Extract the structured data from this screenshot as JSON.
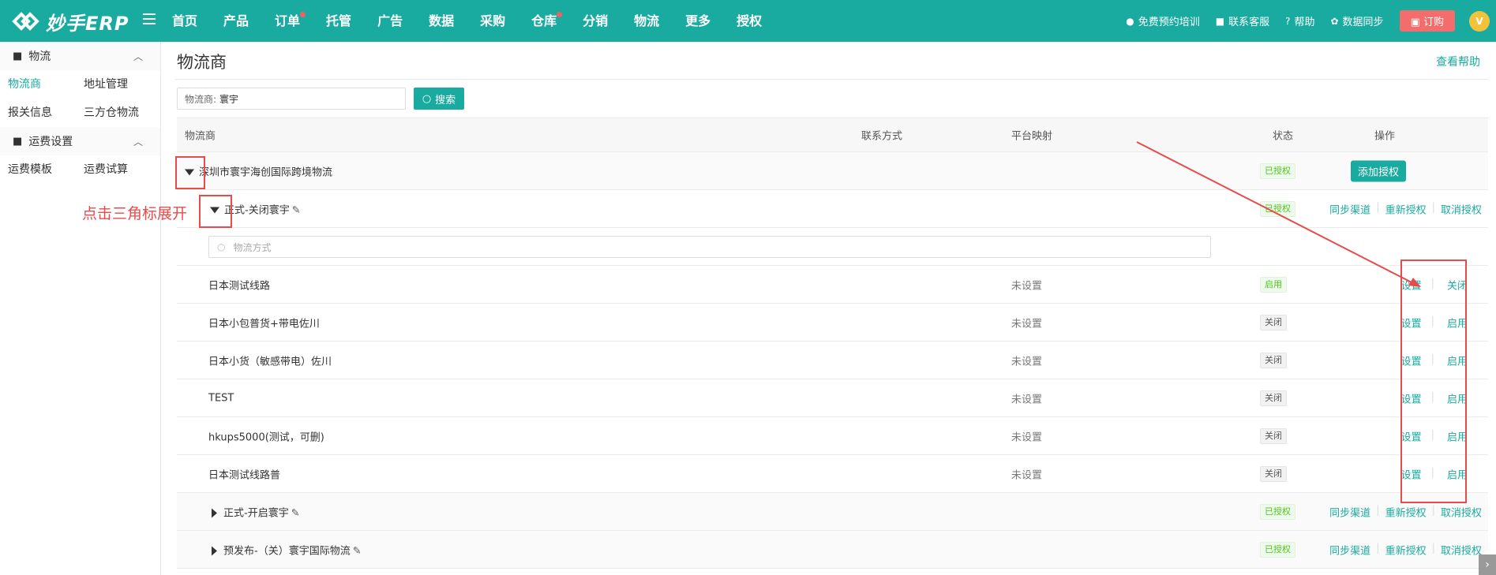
{
  "app": {
    "logo_text": "妙手ERP"
  },
  "nav": {
    "items": [
      {
        "label": "首页",
        "dot": false
      },
      {
        "label": "产品",
        "dot": false
      },
      {
        "label": "订单",
        "dot": true
      },
      {
        "label": "托管",
        "dot": false
      },
      {
        "label": "广告",
        "dot": false
      },
      {
        "label": "数据",
        "dot": false
      },
      {
        "label": "采购",
        "dot": false
      },
      {
        "label": "仓库",
        "dot": true
      },
      {
        "label": "分销",
        "dot": false
      },
      {
        "label": "物流",
        "dot": false
      },
      {
        "label": "更多",
        "dot": false
      },
      {
        "label": "授权",
        "dot": false
      }
    ]
  },
  "header_links": {
    "training": "免费预约培训",
    "support": "联系客服",
    "help": "帮助",
    "sync": "数据同步",
    "order": "订购",
    "avatar": "V"
  },
  "sidebar": {
    "group1": "物流",
    "group1_items": [
      "物流商",
      "地址管理",
      "报关信息",
      "三方仓物流"
    ],
    "group2": "运费设置",
    "group2_items": [
      "运费模板",
      "运费试算"
    ]
  },
  "page": {
    "title": "物流商",
    "help": "查看帮助",
    "search_label": "物流商:",
    "search_value": "寰宇",
    "search_button": "搜索"
  },
  "table": {
    "headers": {
      "name": "物流商",
      "contact": "联系方式",
      "mapping": "平台映射",
      "status": "状态",
      "ops": "操作"
    },
    "provider": {
      "name": "深圳市寰宇海创国际跨境物流",
      "status": "已授权",
      "add_auth": "添加授权"
    },
    "account1": {
      "name": "正式-关闭寰宇",
      "status": "已授权",
      "ops": [
        "同步渠道",
        "重新授权",
        "取消授权"
      ]
    },
    "method_placeholder": "物流方式",
    "lines": [
      {
        "name": "日本测试线路",
        "mapping": "未设置",
        "status": "启用",
        "status_on": true,
        "set": "设置",
        "toggle": "关闭"
      },
      {
        "name": "日本小包普货+带电佐川",
        "mapping": "未设置",
        "status": "关闭",
        "status_on": false,
        "set": "设置",
        "toggle": "启用"
      },
      {
        "name": "日本小货（敏感带电）佐川",
        "mapping": "未设置",
        "status": "关闭",
        "status_on": false,
        "set": "设置",
        "toggle": "启用"
      },
      {
        "name": "TEST",
        "mapping": "未设置",
        "status": "关闭",
        "status_on": false,
        "set": "设置",
        "toggle": "启用"
      },
      {
        "name": "hkups5000(测试，可删)",
        "mapping": "未设置",
        "status": "关闭",
        "status_on": false,
        "set": "设置",
        "toggle": "启用"
      },
      {
        "name": "日本测试线路普",
        "mapping": "未设置",
        "status": "关闭",
        "status_on": false,
        "set": "设置",
        "toggle": "启用"
      }
    ],
    "account2": {
      "name": "正式-开启寰宇",
      "status": "已授权",
      "ops": [
        "同步渠道",
        "重新授权",
        "取消授权"
      ]
    },
    "account3": {
      "name": "预发布-（关）寰宇国际物流",
      "status": "已授权",
      "ops": [
        "同步渠道",
        "重新授权",
        "取消授权"
      ]
    }
  },
  "annotation": {
    "text": "点击三角标展开",
    "color": "#e84b4b"
  },
  "colors": {
    "brand": "#1aaba0",
    "order_button": "#f46d6d"
  }
}
